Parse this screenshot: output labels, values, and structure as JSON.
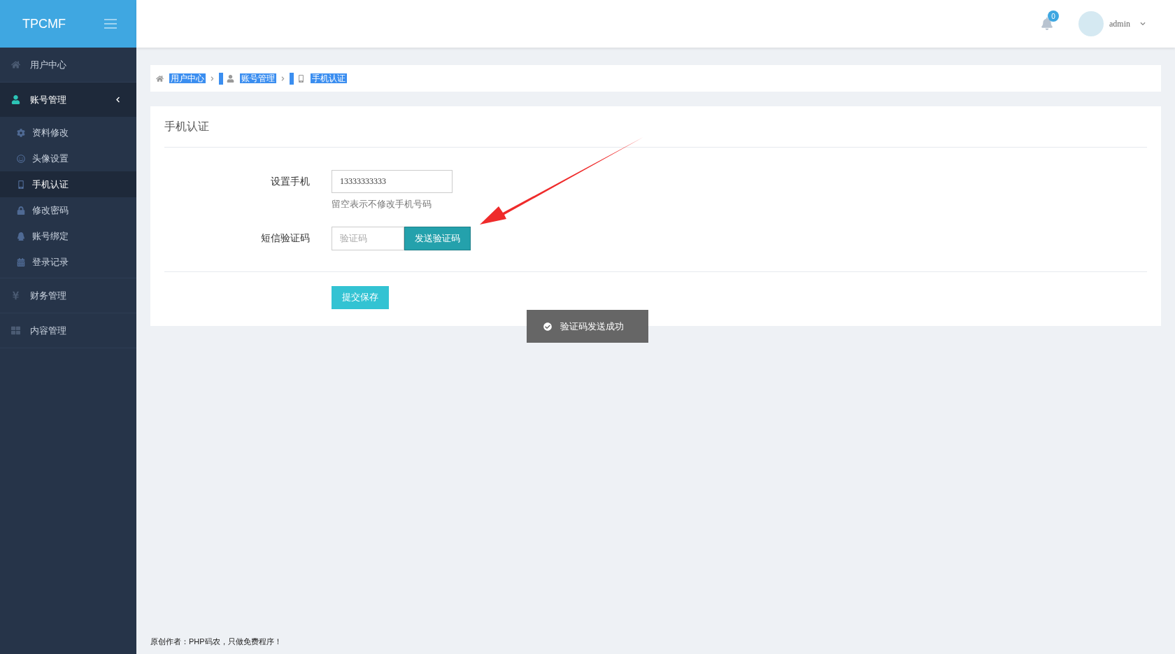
{
  "brand": "TPCMF",
  "header": {
    "notification_count": "0",
    "user": "admin"
  },
  "sidebar": {
    "items": [
      {
        "label": "用户中心",
        "selected": false
      },
      {
        "label": "账号管理",
        "selected": true,
        "expanded": true,
        "children": [
          {
            "label": "资料修改",
            "selected": false
          },
          {
            "label": "头像设置",
            "selected": false
          },
          {
            "label": "手机认证",
            "selected": true
          },
          {
            "label": "修改密码",
            "selected": false
          },
          {
            "label": "账号绑定",
            "selected": false
          },
          {
            "label": "登录记录",
            "selected": false
          }
        ]
      },
      {
        "label": "财务管理",
        "selected": false
      },
      {
        "label": "内容管理",
        "selected": false
      }
    ]
  },
  "breadcrumb": [
    {
      "label": "用户中心"
    },
    {
      "label": "账号管理"
    },
    {
      "label": "手机认证"
    }
  ],
  "card": {
    "title": "手机认证",
    "phone": {
      "label": "设置手机",
      "value": "13333333333",
      "hint": "留空表示不修改手机号码"
    },
    "code": {
      "label": "短信验证码",
      "placeholder": "验证码",
      "button": "发送验证码"
    },
    "submit": "提交保存"
  },
  "toast": "验证码发送成功",
  "footer": "原创作者：PHP码农，只做免费程序！"
}
